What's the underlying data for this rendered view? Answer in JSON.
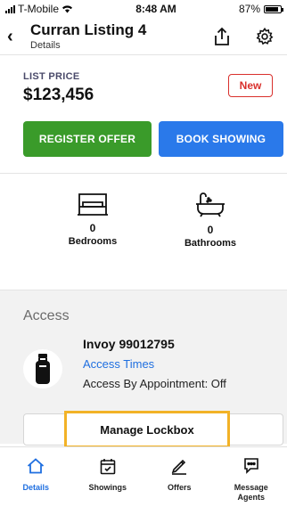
{
  "status": {
    "carrier": "T-Mobile",
    "time": "8:48 AM",
    "battery": "87%",
    "battery_level": 0.87
  },
  "header": {
    "title": "Curran Listing 4",
    "subtitle": "Details",
    "share_icon": "share-icon",
    "settings_icon": "gear-icon"
  },
  "price": {
    "label": "LIST PRICE",
    "value": "$123,456",
    "badge": "New"
  },
  "actions": {
    "register": "REGISTER OFFER",
    "book": "BOOK SHOWING"
  },
  "features": [
    {
      "icon": "bed-icon",
      "count": "0",
      "label": "Bedrooms"
    },
    {
      "icon": "bathtub-icon",
      "count": "0",
      "label": "Bathrooms"
    }
  ],
  "access": {
    "heading": "Access",
    "device": "Invoy 99012795",
    "times_link": "Access Times",
    "appointment": "Access By Appointment: Off",
    "manage": "Manage Lockbox"
  },
  "tabs": [
    {
      "label": "Details",
      "icon": "home-icon"
    },
    {
      "label": "Showings",
      "icon": "calendar-icon"
    },
    {
      "label": "Offers",
      "icon": "pen-icon"
    },
    {
      "label": "Message Agents",
      "icon": "chat-icon"
    }
  ],
  "colors": {
    "accent_blue": "#2a79ea",
    "green": "#3a9b2a",
    "badge_red": "#d9302c",
    "highlight": "#f2b226"
  }
}
